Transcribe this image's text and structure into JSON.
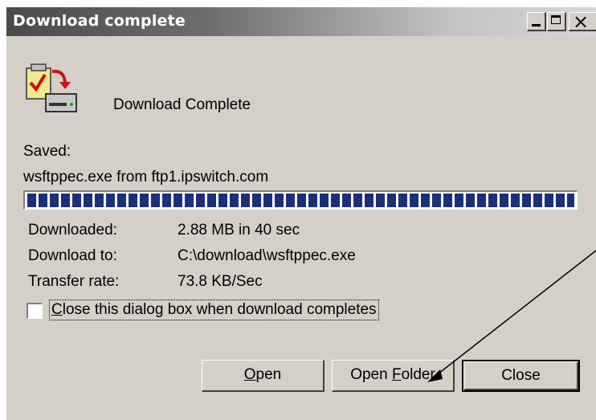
{
  "window": {
    "title": "Download complete",
    "caption_buttons": {
      "minimize": "minimize",
      "maximize": "maximize",
      "close": "×"
    }
  },
  "icon": "download-complete-icon",
  "heading": "Download Complete",
  "saved_label": "Saved:",
  "saved_file": "wsftppec.exe from ftp1.ipswitch.com",
  "progress": {
    "percent": 100
  },
  "details": [
    {
      "label": "Downloaded:",
      "value": "2.88 MB in 40 sec"
    },
    {
      "label": "Download to:",
      "value": "C:\\download\\wsftppec.exe"
    },
    {
      "label": "Transfer rate:",
      "value": "73.8 KB/Sec"
    }
  ],
  "checkbox": {
    "label_prefix": "C",
    "label_rest": "lose this dialog box when download completes",
    "checked": false
  },
  "buttons": {
    "open": {
      "accel": "O",
      "rest": "pen"
    },
    "open_folder": {
      "before": "Open ",
      "accel": "F",
      "rest": "older"
    },
    "close": "Close"
  },
  "colors": {
    "dialog_bg": "#d4d0c8",
    "progress_blue": "#1c2f78",
    "titlebar_dark": "#4a4a4a"
  }
}
